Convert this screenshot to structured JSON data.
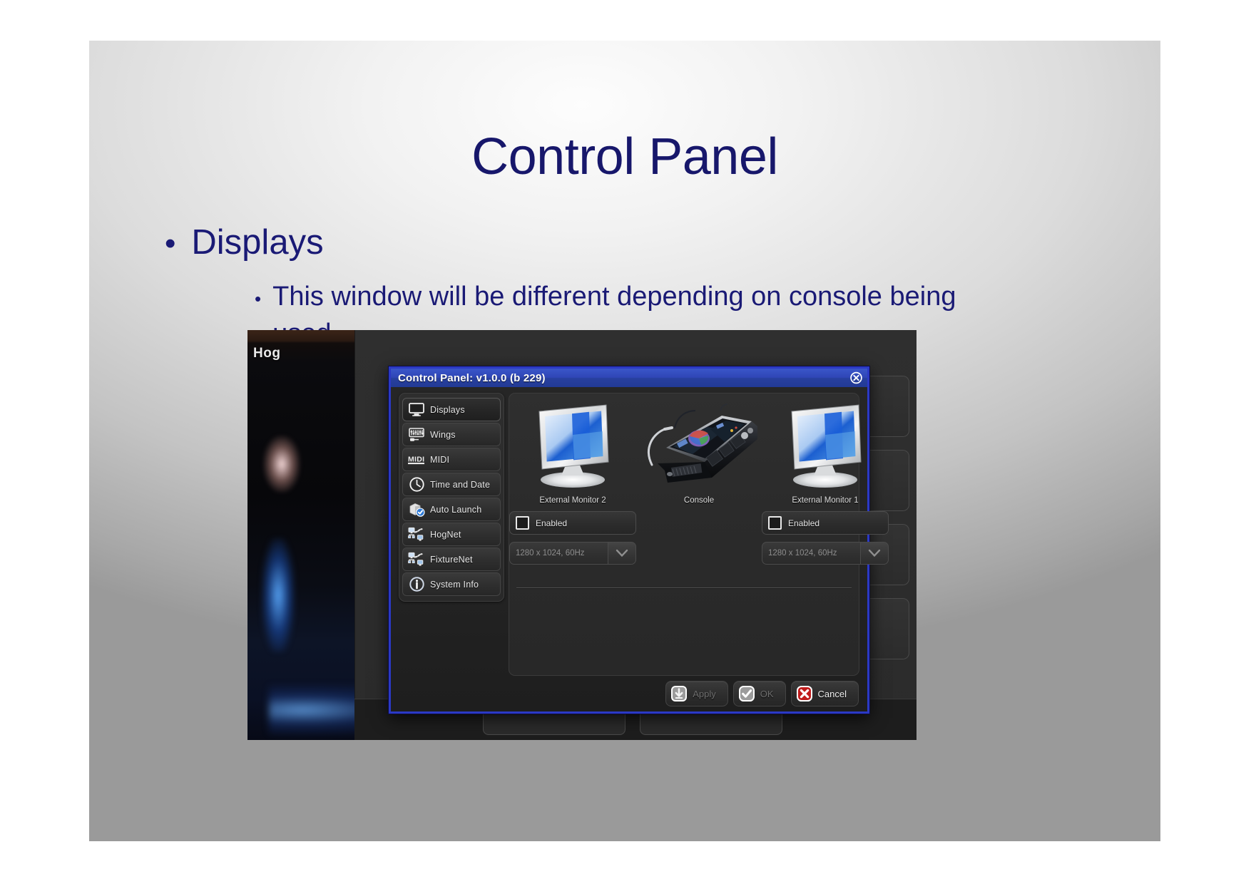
{
  "slide": {
    "title": "Control Panel",
    "bullets": [
      {
        "level": 1,
        "text": "Displays"
      },
      {
        "level": 2,
        "text": "This window will be different depending on console being used."
      }
    ],
    "title_color": "#17176b",
    "bullet_color": "#1a1a75"
  },
  "background_app": {
    "label": "Hog"
  },
  "dialog": {
    "title": "Control Panel: v1.0.0 (b 229)",
    "titlebar_color": "#2f46b6",
    "border_color": "#2b39c4",
    "close_icon": "close-circle-icon",
    "sidebar": {
      "items": [
        {
          "label": "Displays",
          "icon": "monitor-icon",
          "active": true
        },
        {
          "label": "Wings",
          "icon": "wing-faders-icon",
          "active": false
        },
        {
          "label": "MIDI",
          "icon": "midi-icon",
          "active": false
        },
        {
          "label": "Time and Date",
          "icon": "clock-icon",
          "active": false
        },
        {
          "label": "Auto Launch",
          "icon": "box-check-icon",
          "active": false
        },
        {
          "label": "HogNet",
          "icon": "network-icon",
          "active": false
        },
        {
          "label": "FixtureNet",
          "icon": "network-icon",
          "active": false
        },
        {
          "label": "System Info",
          "icon": "info-circle-icon",
          "active": false
        }
      ]
    },
    "displays": [
      {
        "caption": "External Monitor 2",
        "art": "lcd-monitor-icon",
        "enabled_label": "Enabled",
        "enabled_checked": false,
        "resolution_value": "1280 x 1024, 60Hz",
        "has_controls": true
      },
      {
        "caption": "Console",
        "art": "lighting-console-icon",
        "has_controls": false
      },
      {
        "caption": "External Monitor 1",
        "art": "lcd-monitor-icon",
        "enabled_label": "Enabled",
        "enabled_checked": false,
        "resolution_value": "1280 x 1024, 60Hz",
        "has_controls": true
      }
    ],
    "footer": {
      "apply_label": "Apply",
      "ok_label": "OK",
      "cancel_label": "Cancel",
      "apply_enabled": false,
      "ok_enabled": false,
      "cancel_enabled": true,
      "cancel_color": "#c01c1c"
    }
  }
}
